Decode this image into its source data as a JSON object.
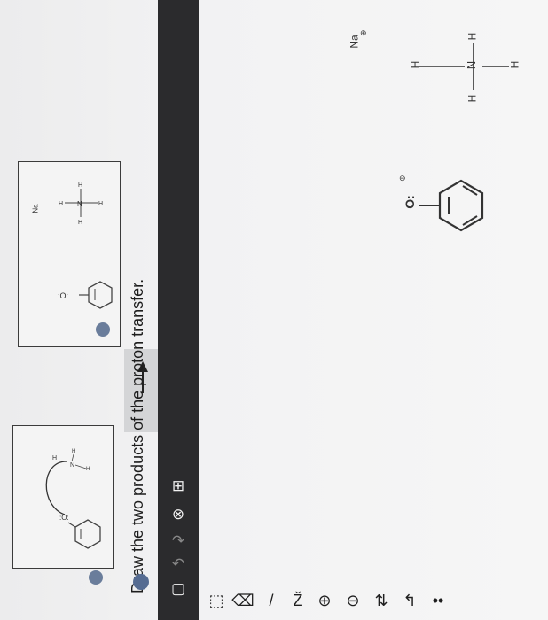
{
  "question": {
    "instruction": "Draw the two products of the proton transfer."
  },
  "reference_panel": {
    "reactant_label_sodium": "Na",
    "reactant_charge_plus": "⊕",
    "amine_atoms": [
      "H",
      "N",
      "H",
      "H"
    ],
    "oxygen_label": "O:"
  },
  "canvas": {
    "sodium_label": "Na",
    "sodium_charge": "⊕",
    "oxygen_label": "O:",
    "oxygen_charge": "⊖",
    "amine_center": "N",
    "amine_h_top": "H",
    "amine_h_left": "H",
    "amine_h_right": "H",
    "amine_h_bottom": "H"
  },
  "toolbar": {
    "items": [
      {
        "name": "select-rectangle-icon",
        "glyph": "▢"
      },
      {
        "name": "undo-icon",
        "glyph": "↶"
      },
      {
        "name": "redo-icon",
        "glyph": "↷"
      },
      {
        "name": "delete-icon",
        "glyph": "⊗"
      },
      {
        "name": "template-icon",
        "glyph": "⊞"
      }
    ]
  },
  "bottom_tools": {
    "items": [
      {
        "name": "lasso-icon",
        "glyph": "⬚"
      },
      {
        "name": "eraser-icon",
        "glyph": "⌫"
      },
      {
        "name": "single-bond-icon",
        "glyph": "/"
      },
      {
        "name": "chain-icon",
        "glyph": "Ž"
      },
      {
        "name": "plus-charge-icon",
        "glyph": "⊕"
      },
      {
        "name": "minus-charge-icon",
        "glyph": "⊖"
      },
      {
        "name": "arrow-tool-icon",
        "glyph": "⇅"
      },
      {
        "name": "curved-arrow-icon",
        "glyph": "↰"
      },
      {
        "name": "lone-pair-icon",
        "glyph": "••"
      }
    ]
  }
}
